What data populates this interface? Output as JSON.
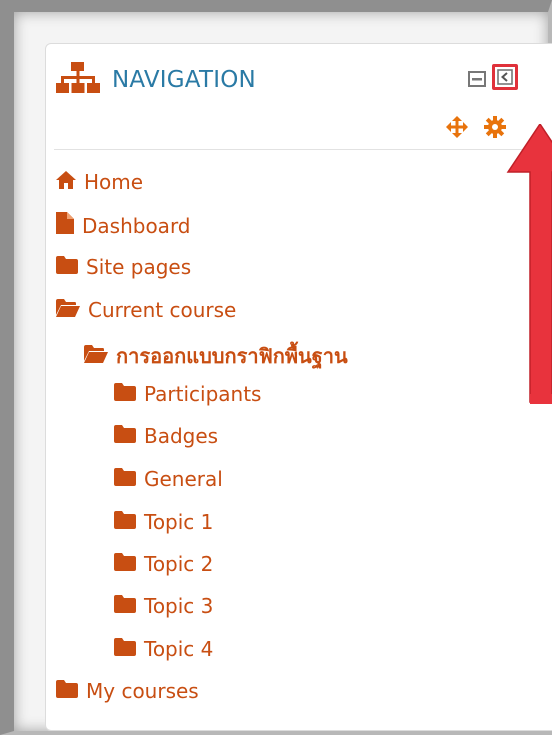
{
  "block": {
    "title": "NAVIGATION",
    "accent_color": "#2a7aa5",
    "link_color": "#c84e12",
    "highlight_color": "#e0313a"
  },
  "nav": {
    "home": "Home",
    "dashboard": "Dashboard",
    "site_pages": "Site pages",
    "current_course": "Current course",
    "course_name": "การออกแบบกราฟิกพื้นฐาน",
    "course_items": [
      "Participants",
      "Badges",
      "General",
      "Topic 1",
      "Topic 2",
      "Topic 3",
      "Topic 4"
    ],
    "my_courses": "My courses"
  },
  "icons": {
    "header": "sitemap-icon",
    "dock": "minus-box-icon",
    "collapse": "collapse-left-icon",
    "move": "move-icon",
    "settings": "gear-icon",
    "home": "home-icon",
    "dashboard": "file-icon",
    "folder": "folder-icon",
    "folder_open": "folder-open-icon",
    "annotation": "red-arrow-up-icon"
  }
}
